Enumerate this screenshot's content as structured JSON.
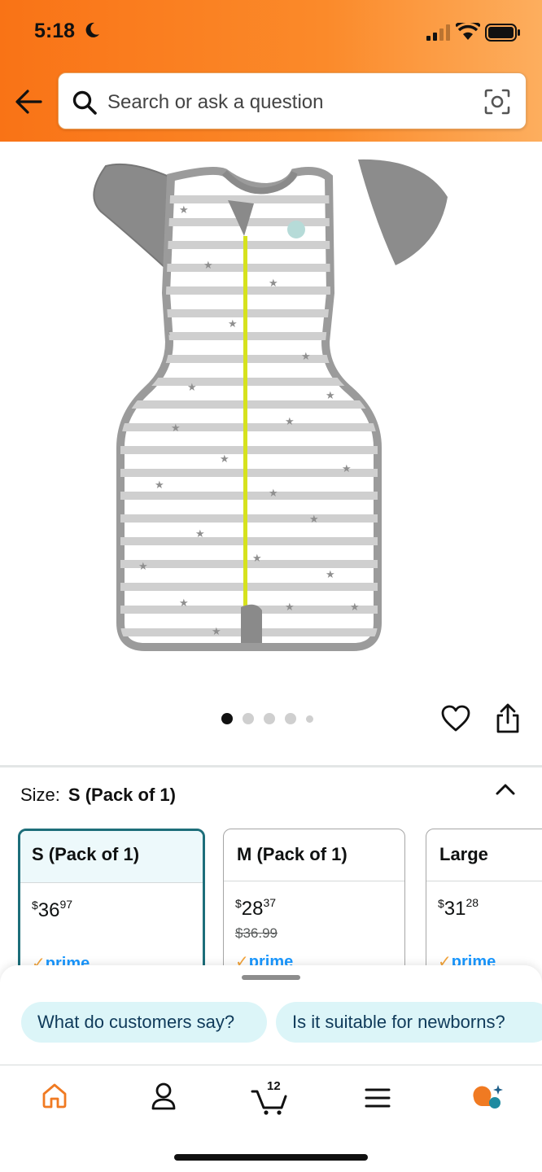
{
  "status_bar": {
    "time": "5:18"
  },
  "search": {
    "placeholder": "Search or ask a question"
  },
  "icons": [
    "back-arrow-icon",
    "search-icon",
    "camera-icon",
    "heart-icon",
    "share-icon",
    "chevron-up-icon",
    "home-icon",
    "account-icon",
    "cart-icon",
    "menu-icon",
    "rufus-icon"
  ],
  "carousel": {
    "total": 5,
    "active_index": 0
  },
  "size": {
    "label": "Size:",
    "selected": "S (Pack of 1)"
  },
  "options": [
    {
      "name": "S (Pack of 1)",
      "currency": "$",
      "dollars": "36",
      "cents": "97",
      "list_price": "",
      "prime": "prime",
      "selected": true
    },
    {
      "name": "M (Pack of 1)",
      "currency": "$",
      "dollars": "28",
      "cents": "37",
      "list_price": "$36.99",
      "prime": "prime",
      "selected": false
    },
    {
      "name": "Large",
      "currency": "$",
      "dollars": "31",
      "cents": "28",
      "list_price": "",
      "prime": "prime",
      "selected": false
    }
  ],
  "suggestions": [
    "What do customers say?",
    "Is it suitable for newborns?"
  ],
  "tabbar": {
    "cart_count": "12"
  },
  "colors": {
    "header_orange": "#f97316",
    "prime_blue": "#1a98ff",
    "selected_teal": "#1d6e7a",
    "chip_bg": "#dcf5f8"
  }
}
